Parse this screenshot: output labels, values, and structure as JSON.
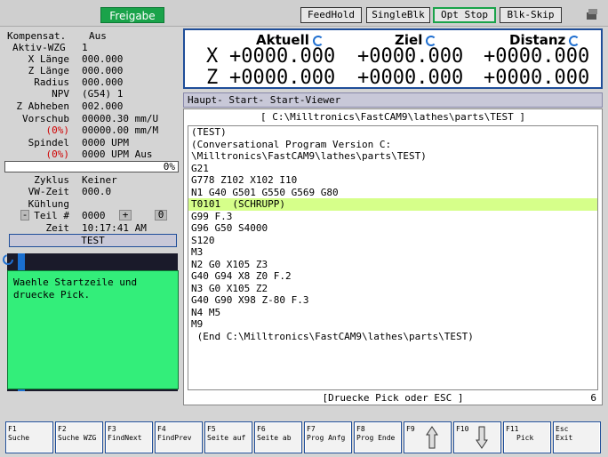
{
  "topbar": {
    "freigabe": "Freigabe",
    "buttons": [
      "FeedHold",
      "SingleBlk",
      "Opt Stop",
      "Blk-Skip"
    ]
  },
  "left": {
    "kompensat_label": "Kompensat.",
    "kompensat_val": "Aus",
    "aktiv_wzg_label": "Aktiv-WZG",
    "aktiv_wzg_val": "1",
    "x_laenge_label": "X Länge",
    "x_laenge_val": "000.000",
    "z_laenge_label": "Z Länge",
    "z_laenge_val": "000.000",
    "radius_label": "Radius",
    "radius_val": "000.000",
    "npv_label": "NPV",
    "npv_val": "(G54) 1",
    "z_abheben_label": "Z Abheben",
    "z_abheben_val": "002.000",
    "vorschub_label": "Vorschub",
    "vorschub_val": "00000.30 mm/U",
    "vorschub_pct": "(0%)",
    "vorschub_val2": "00000.00 mm/M",
    "spindel_label": "Spindel",
    "spindel_val": "0000 UPM",
    "spindel_pct": "(0%)",
    "spindel_val2": "0000 UPM Aus",
    "progress_pct": "0%",
    "zyklus_label": "Zyklus",
    "zyklus_val": "Keiner",
    "vw_zeit_label": "VW-Zeit",
    "vw_zeit_val": "000.0",
    "kuehlung_label": "Kühlung",
    "teil_minus": "-",
    "teil_label": "Teil #",
    "teil_val": "0000",
    "teil_plus": "+",
    "teil_count": "0",
    "zeit_label": "Zeit",
    "zeit_val": "10:17:41 AM",
    "test_label": "TEST"
  },
  "coords": {
    "aktuell": "Aktuell",
    "ziel": "Ziel",
    "distanz": "Distanz",
    "x_axis": "X",
    "z_axis": "Z",
    "x_aktuell": "+0000.000",
    "x_ziel": "+0000.000",
    "x_distanz": "+0000.000",
    "z_aktuell": "+0000.000",
    "z_ziel": "+0000.000",
    "z_distanz": "+0000.000"
  },
  "tabs": "Haupt-  Start-  Start-Viewer",
  "editor": {
    "path": "[ C:\\Milltronics\\FastCAM9\\lathes\\parts\\TEST ]",
    "lines": [
      "(TEST)",
      "(Conversational Program Version C:",
      "\\Milltronics\\FastCAM9\\lathes\\parts\\TEST)",
      "G21",
      "G778 Z102 X102 I10",
      "N1 G40 G501 G550 G569 G80",
      "T0101  (SCHRUPP)",
      "G99 F.3",
      "G96 G50 S4000",
      "S120",
      "M3",
      "N2 G0 X105 Z3",
      "G40 G94 X8 Z0 F.2",
      "N3 G0 X105 Z2",
      "G40 G90 X98 Z-80 F.3",
      "N4 M5",
      "M9",
      " (End C:\\Milltronics\\FastCAM9\\lathes\\parts\\TEST)"
    ],
    "status": "[Druecke Pick oder ESC ]",
    "line_count": "6"
  },
  "message": "Waehle Startzeile und druecke Pick.",
  "fkeys": [
    {
      "num": "F1",
      "label": "Suche"
    },
    {
      "num": "F2",
      "label": "Suche WZG"
    },
    {
      "num": "F3",
      "label": "FindNext"
    },
    {
      "num": "F4",
      "label": "FindPrev"
    },
    {
      "num": "F5",
      "label": "Seite auf"
    },
    {
      "num": "F6",
      "label": "Seite ab"
    },
    {
      "num": "F7",
      "label": "Prog Anfg"
    },
    {
      "num": "F8",
      "label": "Prog Ende"
    },
    {
      "num": "F9",
      "label": ""
    },
    {
      "num": "F10",
      "label": ""
    },
    {
      "num": "F11",
      "label": "Pick"
    },
    {
      "num": "Esc",
      "label": "Exit"
    }
  ],
  "colors": {
    "accent": "#1f4e99",
    "freigabe": "#1aa34a",
    "highlight": "#d6ff8a",
    "message_bg": "#33ee7a"
  }
}
